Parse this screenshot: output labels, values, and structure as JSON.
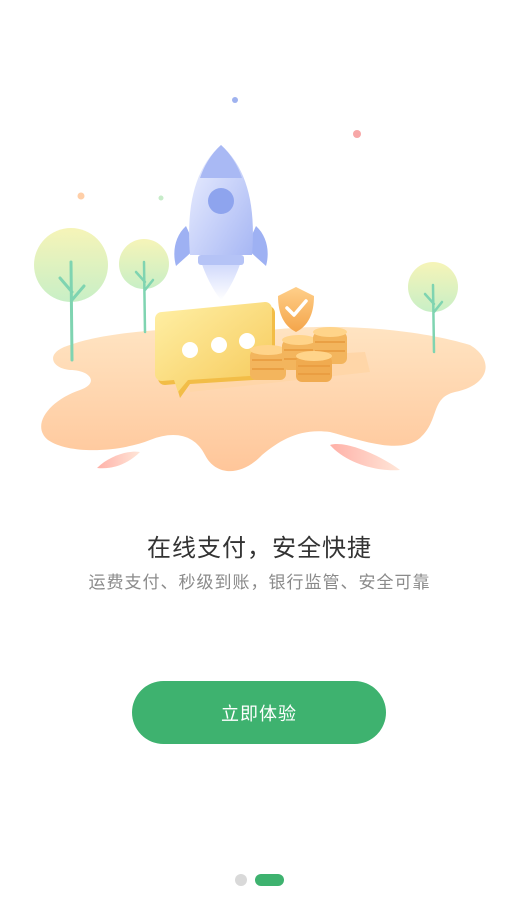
{
  "onboarding": {
    "title": "在线支付，安全快捷",
    "subtitle": "运费支付、秒级到账，银行监管、安全可靠",
    "cta_label": "立即体验"
  },
  "pager": {
    "total": 2,
    "active_index": 1
  },
  "colors": {
    "accent": "#3eb26f",
    "title": "#333333",
    "subtitle": "#8a8a8a",
    "dot_inactive": "#d9d9d9"
  },
  "illustration": {
    "elements": [
      "rocket-icon",
      "shield-check-icon",
      "chat-bubble-icon",
      "coin-stack-icon",
      "tree-icon"
    ]
  }
}
